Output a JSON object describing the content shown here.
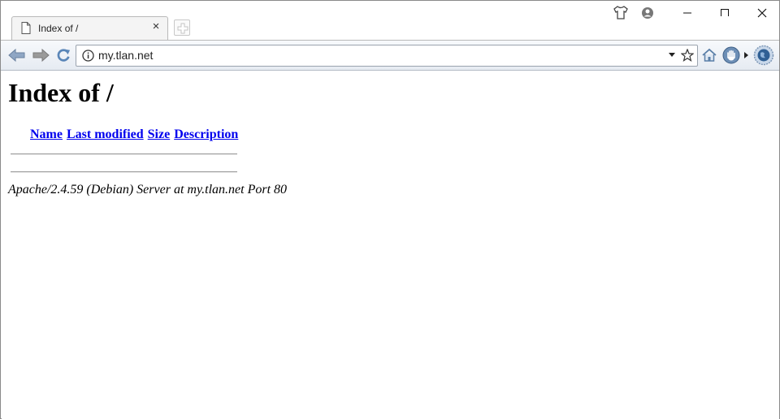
{
  "browser": {
    "tab": {
      "title": "Index of /",
      "icon": "document-icon"
    },
    "url": "my.tlan.net",
    "icons": [
      "shirt-icon",
      "profile-icon",
      "minimize-icon",
      "maximize-icon",
      "close-icon",
      "back-arrow-icon",
      "forward-arrow-icon",
      "reload-icon",
      "info-icon",
      "star-icon",
      "home-icon",
      "hand-icon",
      "globe-icon"
    ]
  },
  "page": {
    "heading": "Index of /",
    "columns": [
      "Name",
      "Last modified",
      "Size",
      "Description"
    ],
    "footer": "Apache/2.4.59 (Debian) Server at my.tlan.net Port 80"
  },
  "colors": {
    "link": "#0000ee",
    "toolbar": "#e6ebf2"
  }
}
